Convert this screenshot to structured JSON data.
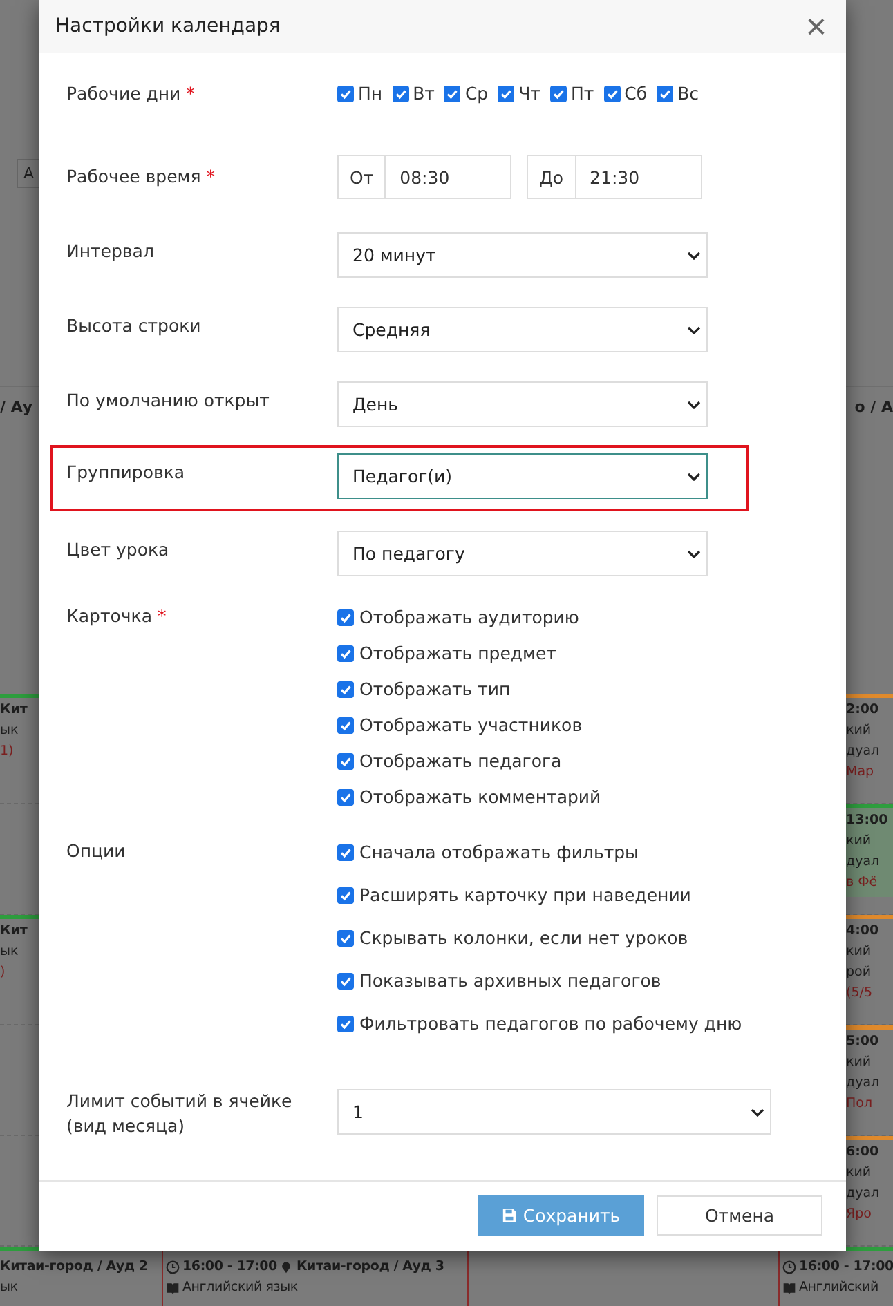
{
  "calendar": {
    "toolbar_fragment": "А",
    "column_headers": [
      "/ Ау",
      "о / А"
    ],
    "left_slots": [
      {
        "kind": "event",
        "color": "#2e9e3e",
        "lines": [
          "Кит",
          "ык",
          "1)"
        ]
      },
      {
        "kind": "empty"
      },
      {
        "kind": "event",
        "color": "#2e9e3e",
        "lines": [
          "Кит",
          "ык",
          ")"
        ]
      },
      {
        "kind": "empty"
      },
      {
        "kind": "empty"
      }
    ],
    "right_slots": [
      {
        "kind": "event",
        "color": "#e08a2c",
        "highlighted": false,
        "lines": [
          "2:00",
          "кий",
          "дуал",
          "Мар"
        ]
      },
      {
        "kind": "event",
        "color": "#2e9e3e",
        "highlighted": true,
        "lines": [
          "13:00",
          "кий",
          "дуал",
          "в Фё"
        ]
      },
      {
        "kind": "event",
        "color": "#e08a2c",
        "highlighted": false,
        "lines": [
          "4:00",
          "кий",
          "рой",
          "(5/5"
        ]
      },
      {
        "kind": "event",
        "color": "#e08a2c",
        "highlighted": false,
        "lines": [
          "5:00",
          "кий",
          "дуал",
          "Пол"
        ]
      },
      {
        "kind": "event",
        "color": "#e08a2c",
        "highlighted": false,
        "lines": [
          "6:00",
          "кий",
          "дуал",
          "Яро"
        ]
      }
    ],
    "bottom_events": [
      {
        "kind": "event",
        "place": "Китаи-город / Ауд 2",
        "subject": "ык"
      },
      {
        "kind": "event",
        "time": "16:00 - 17:00",
        "place": "Китаи-город / Ауд 3",
        "subject": "Английский язык"
      },
      {
        "kind": "empty"
      },
      {
        "kind": "event",
        "time": "16:00 - 17:00",
        "subject": "Английский"
      }
    ]
  },
  "dialog": {
    "title": "Настройки календаря",
    "close": "×",
    "fields": [
      {
        "kind": "days",
        "label": "Рабочие дни",
        "marker": "*",
        "options": [
          {
            "label": "Пн",
            "checked": true
          },
          {
            "label": "Вт",
            "checked": true
          },
          {
            "label": "Ср",
            "checked": true
          },
          {
            "label": "Чт",
            "checked": true
          },
          {
            "label": "Пт",
            "checked": true
          },
          {
            "label": "Сб",
            "checked": true
          },
          {
            "label": "Вс",
            "checked": true
          }
        ]
      },
      {
        "kind": "time_range",
        "label": "Рабочее время",
        "marker": "*",
        "ranges": [
          {
            "addon": "От",
            "value": "08:30"
          },
          {
            "addon": "До",
            "value": "21:30"
          }
        ]
      },
      {
        "kind": "select",
        "label": "Интервал",
        "value": "20 минут",
        "highlighted": false
      },
      {
        "kind": "select",
        "label": "Высота строки",
        "value": "Средняя",
        "highlighted": false
      },
      {
        "kind": "select",
        "label": "По умолчанию открыт",
        "value": "День",
        "highlighted": false
      },
      {
        "kind": "select",
        "label": "Группировка",
        "value": "Педагог(и)",
        "highlighted": true
      },
      {
        "kind": "select",
        "label": "Цвет урока",
        "value": "По педагогу",
        "highlighted": false
      },
      {
        "kind": "checkboxes",
        "label": "Карточка",
        "marker": "*",
        "options": [
          {
            "label": "Отображать аудиторию",
            "checked": true
          },
          {
            "label": "Отображать предмет",
            "checked": true
          },
          {
            "label": "Отображать тип",
            "checked": true
          },
          {
            "label": "Отображать участников",
            "checked": true
          },
          {
            "label": "Отображать педагога",
            "checked": true
          },
          {
            "label": "Отображать комментарий",
            "checked": true
          }
        ]
      },
      {
        "kind": "options",
        "label": "Опции",
        "options": [
          {
            "label": "Сначала отображать фильтры",
            "checked": true
          },
          {
            "label": "Расширять карточку при наведении",
            "checked": true
          },
          {
            "label": "Скрывать колонки, если нет уроков",
            "checked": true
          },
          {
            "label": "Показывать архивных педагогов",
            "checked": true
          },
          {
            "label": "Фильтровать педагогов по рабочему дню",
            "checked": true
          }
        ]
      },
      {
        "kind": "select_wide",
        "label": "Лимит событий в ячейке (вид месяца)",
        "value": "1",
        "highlighted": false
      }
    ],
    "buttons": [
      {
        "kind": "primary",
        "label": "Сохранить"
      },
      {
        "kind": "secondary",
        "label": "Отмена"
      }
    ]
  }
}
